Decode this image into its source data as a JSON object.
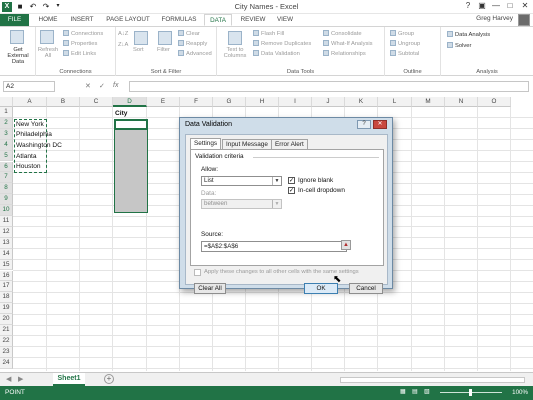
{
  "window": {
    "title": "City Names - Excel",
    "help": "?",
    "minimize": "—",
    "maximize": "□",
    "close": "✕",
    "undo": "↶",
    "redo": "↷",
    "logo": "X"
  },
  "tabs": [
    "FILE",
    "HOME",
    "INSERT",
    "PAGE LAYOUT",
    "FORMULAS",
    "DATA",
    "REVIEW",
    "VIEW"
  ],
  "active_tab": "DATA",
  "user": "Greg Harvey",
  "ribbon": {
    "get_external_data": "Get External Data",
    "refresh_all": "Refresh All",
    "connections": "Connections",
    "properties": "Properties",
    "edit_links": "Edit Links",
    "sort": "Sort",
    "filter": "Filter",
    "clear": "Clear",
    "reapply": "Reapply",
    "advanced": "Advanced",
    "text_to_columns": "Text to Columns",
    "flash_fill": "Flash Fill",
    "remove_duplicates": "Remove Duplicates",
    "data_validation": "Data Validation",
    "consolidate": "Consolidate",
    "what_if": "What-If Analysis",
    "relationships": "Relationships",
    "group": "Group",
    "ungroup": "Ungroup",
    "subtotal": "Subtotal",
    "data_analysis": "Data Analysis",
    "solver": "Solver",
    "groups": {
      "connections": "Connections",
      "sort_filter": "Sort & Filter",
      "data_tools": "Data Tools",
      "outline": "Outline",
      "analysis": "Analysis"
    }
  },
  "formula_bar": {
    "name_box": "A2",
    "fx": "fx",
    "cancel": "✕",
    "enter": "✓",
    "formula": ""
  },
  "columns": [
    "A",
    "B",
    "C",
    "D",
    "E",
    "F",
    "G",
    "H",
    "I",
    "J",
    "K",
    "L",
    "M",
    "N",
    "O"
  ],
  "rows": [
    "1",
    "2",
    "3",
    "4",
    "5",
    "6",
    "7",
    "8",
    "9",
    "10",
    "11",
    "12",
    "13",
    "14",
    "15",
    "16",
    "17",
    "18",
    "19",
    "20",
    "21",
    "22",
    "23",
    "24"
  ],
  "cells": {
    "d1": "City",
    "cities": [
      "New York",
      "Philadelphia",
      "Washington DC",
      "Atlanta",
      "Houston"
    ]
  },
  "sheet": {
    "name": "Sheet1",
    "add": "+",
    "nav_prev": "◀",
    "nav_next": "▶"
  },
  "status": {
    "text": "POINT",
    "zoom": "100%"
  },
  "dialog": {
    "title": "Data Validation",
    "help": "?",
    "close": "✕",
    "tabs": [
      "Settings",
      "Input Message",
      "Error Alert"
    ],
    "criteria_label": "Validation criteria",
    "allow_label": "Allow:",
    "allow_value": "List",
    "data_label": "Data:",
    "data_value": "between",
    "ignore_blank": "Ignore blank",
    "in_cell_dropdown": "In-cell dropdown",
    "source_label": "Source:",
    "source_value": "=$A$2:$A$6",
    "apply_all": "Apply these changes to all other cells with the same settings",
    "clear_all": "Clear All",
    "ok": "OK",
    "cancel": "Cancel"
  }
}
